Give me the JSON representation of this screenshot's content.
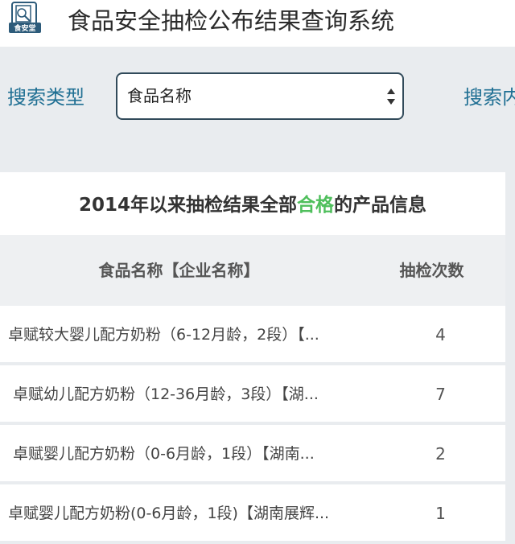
{
  "header": {
    "logo_text": "食安堂",
    "title": "食品安全抽检公布结果查询系统"
  },
  "search": {
    "type_label": "搜索类型",
    "type_value": "食品名称",
    "content_label": "搜索内"
  },
  "results": {
    "heading_before": "2014年以来抽检结果全部",
    "heading_highlight": "合格",
    "heading_after": "的产品信息",
    "highlight_color": "#4fbf5c",
    "columns": {
      "name": "食品名称【企业名称】",
      "count": "抽检次数"
    },
    "rows": [
      {
        "name": "卓赋较大婴儿配方奶粉（6-12月龄，2段）【...",
        "count": "4"
      },
      {
        "name": "卓赋幼儿配方奶粉（12-36月龄，3段）【湖...",
        "count": "7"
      },
      {
        "name": "卓赋婴儿配方奶粉（0-6月龄，1段）【湖南...",
        "count": "2"
      },
      {
        "name": "卓赋婴儿配方奶粉(0-6月龄，1段)【湖南展辉...",
        "count": "1"
      }
    ]
  }
}
